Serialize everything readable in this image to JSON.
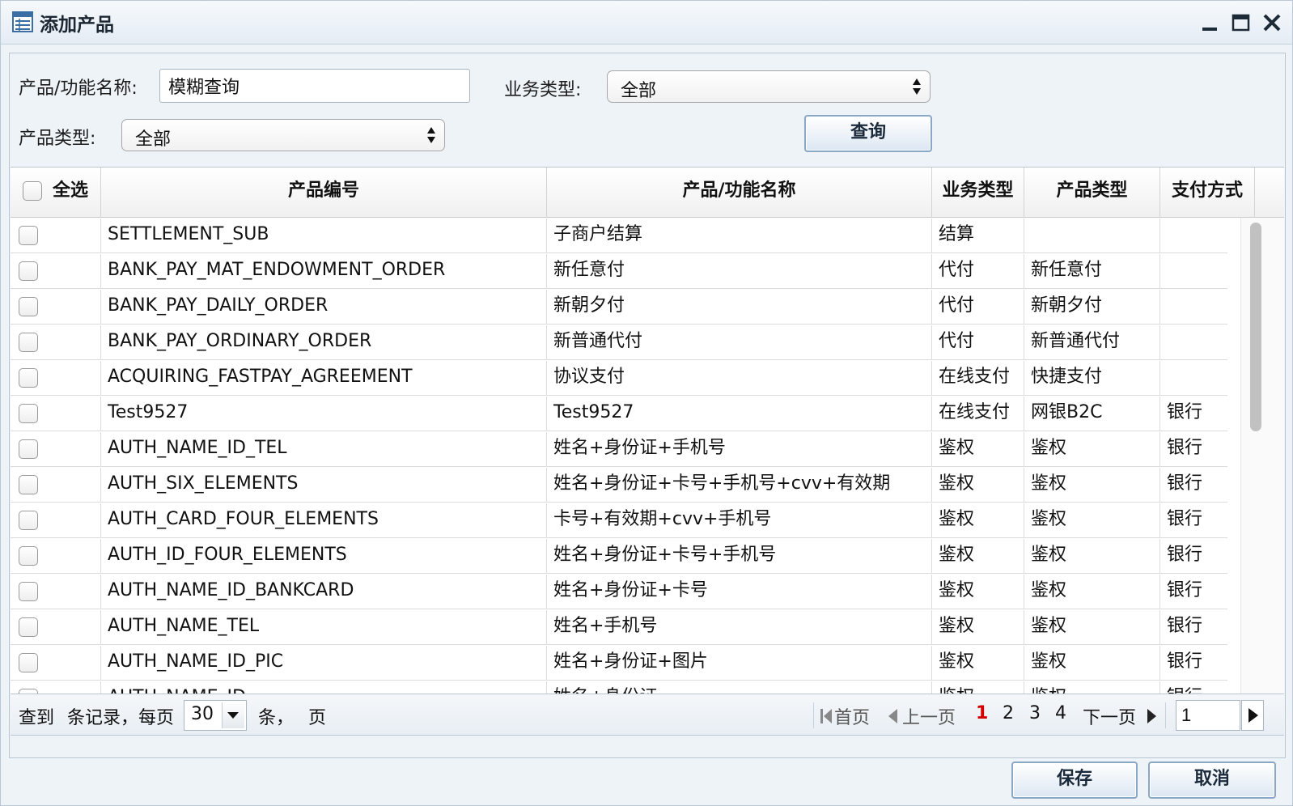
{
  "window": {
    "title": "添加产品",
    "icon": "table-icon"
  },
  "filters": {
    "name_label": "产品/功能名称:",
    "name_value": "模糊查询",
    "biz_type_label": "业务类型:",
    "biz_type_value": "全部",
    "product_type_label": "产品类型:",
    "product_type_value": "全部",
    "query_button": "查询"
  },
  "table": {
    "select_all_label": "全选",
    "columns": [
      "产品编号",
      "产品/功能名称",
      "业务类型",
      "产品类型",
      "支付方式"
    ],
    "rows": [
      {
        "code": "SETTLEMENT_SUB",
        "name": "子商户结算",
        "biz": "结算",
        "ptype": "",
        "pay": ""
      },
      {
        "code": "BANK_PAY_MAT_ENDOWMENT_ORDER",
        "name": "新任意付",
        "biz": "代付",
        "ptype": "新任意付",
        "pay": ""
      },
      {
        "code": "BANK_PAY_DAILY_ORDER",
        "name": "新朝夕付",
        "biz": "代付",
        "ptype": "新朝夕付",
        "pay": ""
      },
      {
        "code": "BANK_PAY_ORDINARY_ORDER",
        "name": "新普通代付",
        "biz": "代付",
        "ptype": "新普通代付",
        "pay": ""
      },
      {
        "code": "ACQUIRING_FASTPAY_AGREEMENT",
        "name": "协议支付",
        "biz": "在线支付",
        "ptype": "快捷支付",
        "pay": ""
      },
      {
        "code": "Test9527",
        "name": "Test9527",
        "biz": "在线支付",
        "ptype": "网银B2C",
        "pay": "银行"
      },
      {
        "code": "AUTH_NAME_ID_TEL",
        "name": "姓名+身份证+手机号",
        "biz": "鉴权",
        "ptype": "鉴权",
        "pay": "银行"
      },
      {
        "code": "AUTH_SIX_ELEMENTS",
        "name": "姓名+身份证+卡号+手机号+cvv+有效期",
        "biz": "鉴权",
        "ptype": "鉴权",
        "pay": "银行"
      },
      {
        "code": "AUTH_CARD_FOUR_ELEMENTS",
        "name": "卡号+有效期+cvv+手机号",
        "biz": "鉴权",
        "ptype": "鉴权",
        "pay": "银行"
      },
      {
        "code": "AUTH_ID_FOUR_ELEMENTS",
        "name": "姓名+身份证+卡号+手机号",
        "biz": "鉴权",
        "ptype": "鉴权",
        "pay": "银行"
      },
      {
        "code": "AUTH_NAME_ID_BANKCARD",
        "name": "姓名+身份证+卡号",
        "biz": "鉴权",
        "ptype": "鉴权",
        "pay": "银行"
      },
      {
        "code": "AUTH_NAME_TEL",
        "name": "姓名+手机号",
        "biz": "鉴权",
        "ptype": "鉴权",
        "pay": "银行"
      },
      {
        "code": "AUTH_NAME_ID_PIC",
        "name": "姓名+身份证+图片",
        "biz": "鉴权",
        "ptype": "鉴权",
        "pay": "银行"
      },
      {
        "code": "AUTH_NAME_ID",
        "name": "姓名+身份证",
        "biz": "鉴权",
        "ptype": "鉴权",
        "pay": "银行"
      }
    ]
  },
  "pager": {
    "found": "查到",
    "records_per_page": "条记录，每页",
    "page_size": "30",
    "items_suffix": "条，",
    "pages_suffix": "页",
    "first": "首页",
    "prev": "上一页",
    "pages": [
      "1",
      "2",
      "3",
      "4"
    ],
    "current_page": "1",
    "next": "下一页",
    "goto_value": "1"
  },
  "actions": {
    "save": "保存",
    "cancel": "取消"
  }
}
